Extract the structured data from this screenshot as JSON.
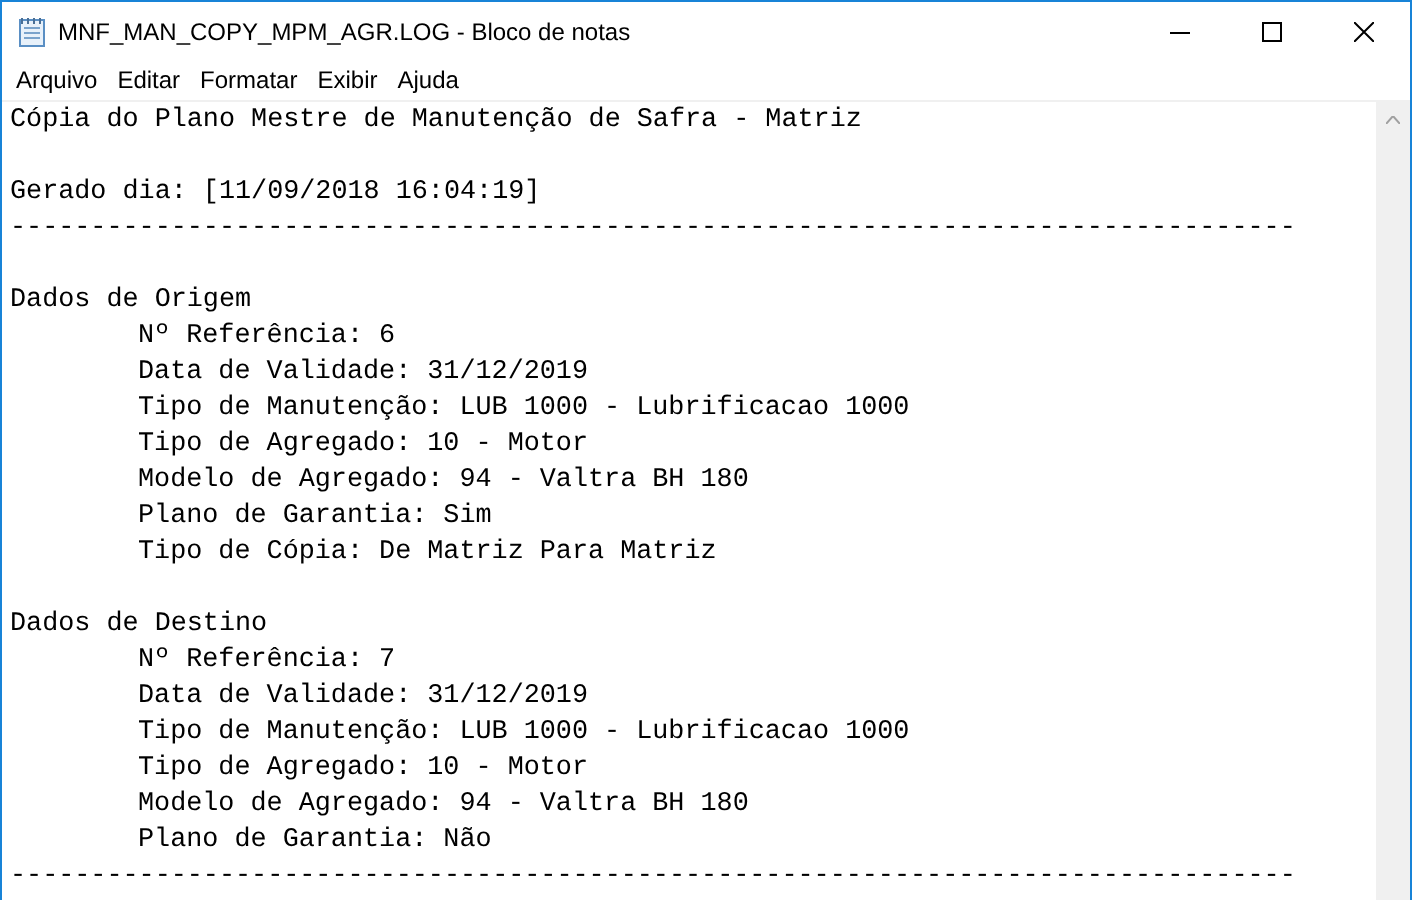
{
  "window": {
    "title": "MNF_MAN_COPY_MPM_AGR.LOG - Bloco de notas"
  },
  "menu": [
    {
      "label": "Arquivo"
    },
    {
      "label": "Editar"
    },
    {
      "label": "Formatar"
    },
    {
      "label": "Exibir"
    },
    {
      "label": "Ajuda"
    }
  ],
  "document": {
    "blocks": [
      {
        "lines": [
          {
            "text": "Cópia do Plano Mestre de Manutenção de Safra - Matriz"
          }
        ]
      },
      {
        "lines": [
          {
            "text": "Gerado dia: [11/09/2018 16:04:19]"
          },
          {
            "text": "--------------------------------------------------------------------------------"
          }
        ]
      },
      {
        "lines": [
          {
            "text": "Dados de Origem",
            "children": [
              {
                "text": "Nº Referência: 6"
              },
              {
                "text": "Data de Validade: 31/12/2019"
              },
              {
                "text": "Tipo de Manutenção: LUB 1000 - Lubrificacao 1000"
              },
              {
                "text": "Tipo de Agregado: 10 - Motor"
              },
              {
                "text": "Modelo de Agregado: 94 - Valtra BH 180"
              },
              {
                "text": "Plano de Garantia: Sim"
              },
              {
                "text": "Tipo de Cópia: De Matriz Para Matriz"
              }
            ]
          }
        ]
      },
      {
        "lines": [
          {
            "text": "Dados de Destino",
            "children": [
              {
                "text": "Nº Referência: 7"
              },
              {
                "text": "Data de Validade: 31/12/2019"
              },
              {
                "text": "Tipo de Manutenção: LUB 1000 - Lubrificacao 1000"
              },
              {
                "text": "Tipo de Agregado: 10 - Motor"
              },
              {
                "text": "Modelo de Agregado: 94 - Valtra BH 180"
              },
              {
                "text": "Plano de Garantia: Não"
              }
            ]
          },
          {
            "text": "--------------------------------------------------------------------------------"
          }
        ]
      }
    ]
  }
}
